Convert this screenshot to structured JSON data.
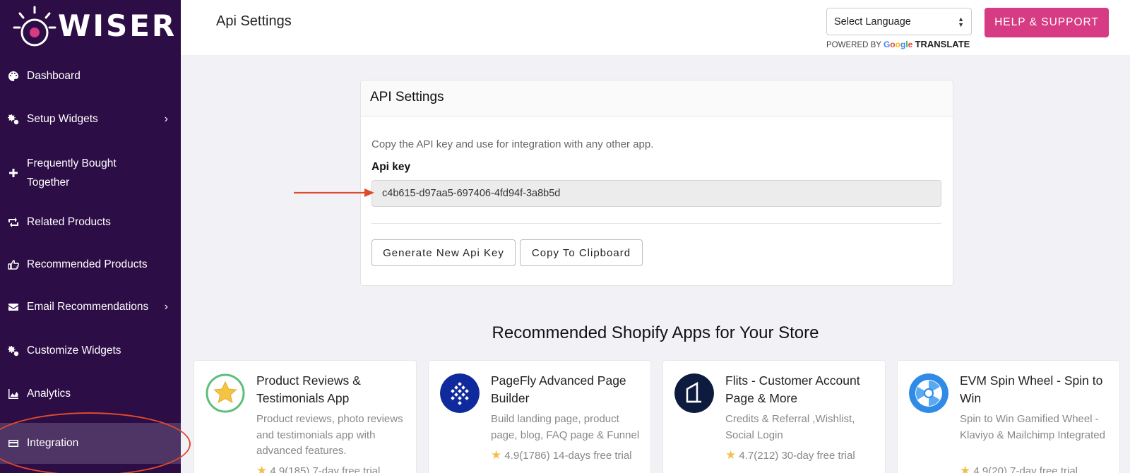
{
  "brand": {
    "name": "WISER"
  },
  "sidebar": {
    "items": [
      {
        "label": "Dashboard",
        "icon": "palette-icon"
      },
      {
        "label": "Setup Widgets",
        "icon": "gears-icon",
        "has_submenu": true
      },
      {
        "label": "Frequently Bought",
        "label2": "Together",
        "icon": "plus-icon"
      },
      {
        "label": "Related Products",
        "icon": "retweet-icon"
      },
      {
        "label": "Recommended Products",
        "icon": "hand-point-icon"
      },
      {
        "label": "Email Recommendations",
        "icon": "envelope-icon",
        "has_submenu": true
      },
      {
        "label": "Customize Widgets",
        "icon": "gears-icon"
      },
      {
        "label": "Analytics",
        "icon": "area-chart-icon"
      },
      {
        "label": "Integration",
        "icon": "credit-card-icon",
        "active": true
      }
    ]
  },
  "header": {
    "title": "Api Settings",
    "language_select": {
      "selected": "Select Language"
    },
    "powered_by": "POWERED BY",
    "google": "Google",
    "translate": "TRANSLATE",
    "help_button": "HELP & SUPPORT"
  },
  "api_card": {
    "heading": "API Settings",
    "description": "Copy the API key and use for integration with any other app.",
    "key_label": "Api key",
    "key_value": "c4b615-d97aa5-697406-4fd94f-3a8b5d",
    "generate_button": "Generate New Api Key",
    "copy_button": "Copy To Clipboard"
  },
  "recommended": {
    "title": "Recommended Shopify Apps for Your Store",
    "apps": [
      {
        "name": "Product Reviews & Testimonials App",
        "description": "Product reviews, photo reviews and testimonials app with advanced features.",
        "rating": "4.9(185) 7-day free trial"
      },
      {
        "name": "PageFly Advanced Page Builder",
        "description": "Build landing page, product page, blog, FAQ page & Funnel",
        "rating": "4.9(1786) 14-days free trial"
      },
      {
        "name": "Flits - Customer Account Page & More",
        "description": "Credits & Referral ,Wishlist, Social Login",
        "rating": "4.7(212) 30-day free trial"
      },
      {
        "name": "EVM Spin Wheel - Spin to Win",
        "description": "Spin to Win Gamified Wheel - Klaviyo & Mailchimp Integrated",
        "rating": "4.9(20) 7-day free trial"
      }
    ]
  },
  "colors": {
    "sidebar_bg": "#2c0d45",
    "sidebar_active": "#4e3566",
    "accent_pink": "#d63b83",
    "highlight_red": "#e04a2b"
  }
}
